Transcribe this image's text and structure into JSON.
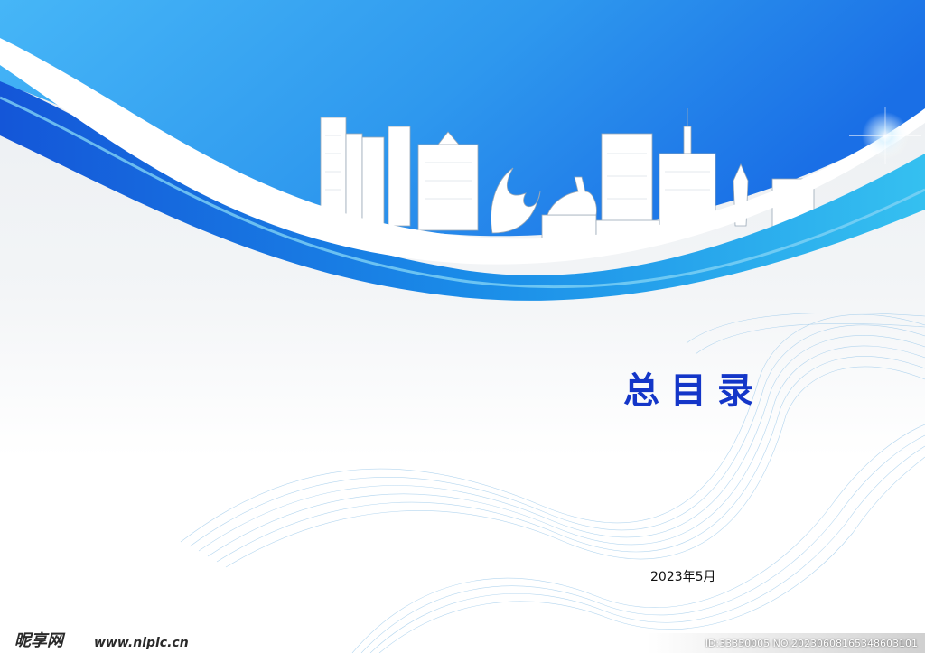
{
  "document": {
    "title": "总目录",
    "date": "2023年5月"
  },
  "watermark": {
    "site_logo": "昵享网",
    "site_url": "www.nipic.cn",
    "image_id": "ID:33350005 NO:20230608165348603101"
  },
  "colors": {
    "title_blue": "#1436c8",
    "sky_blue": "#2f9ef0",
    "deep_blue": "#1565e0",
    "wave_line_blue": "#9cc9ea"
  },
  "decorations": {
    "header_banner": "city-skyline",
    "sparkle": "lens-flare",
    "background_lines": "mesh-waves"
  }
}
